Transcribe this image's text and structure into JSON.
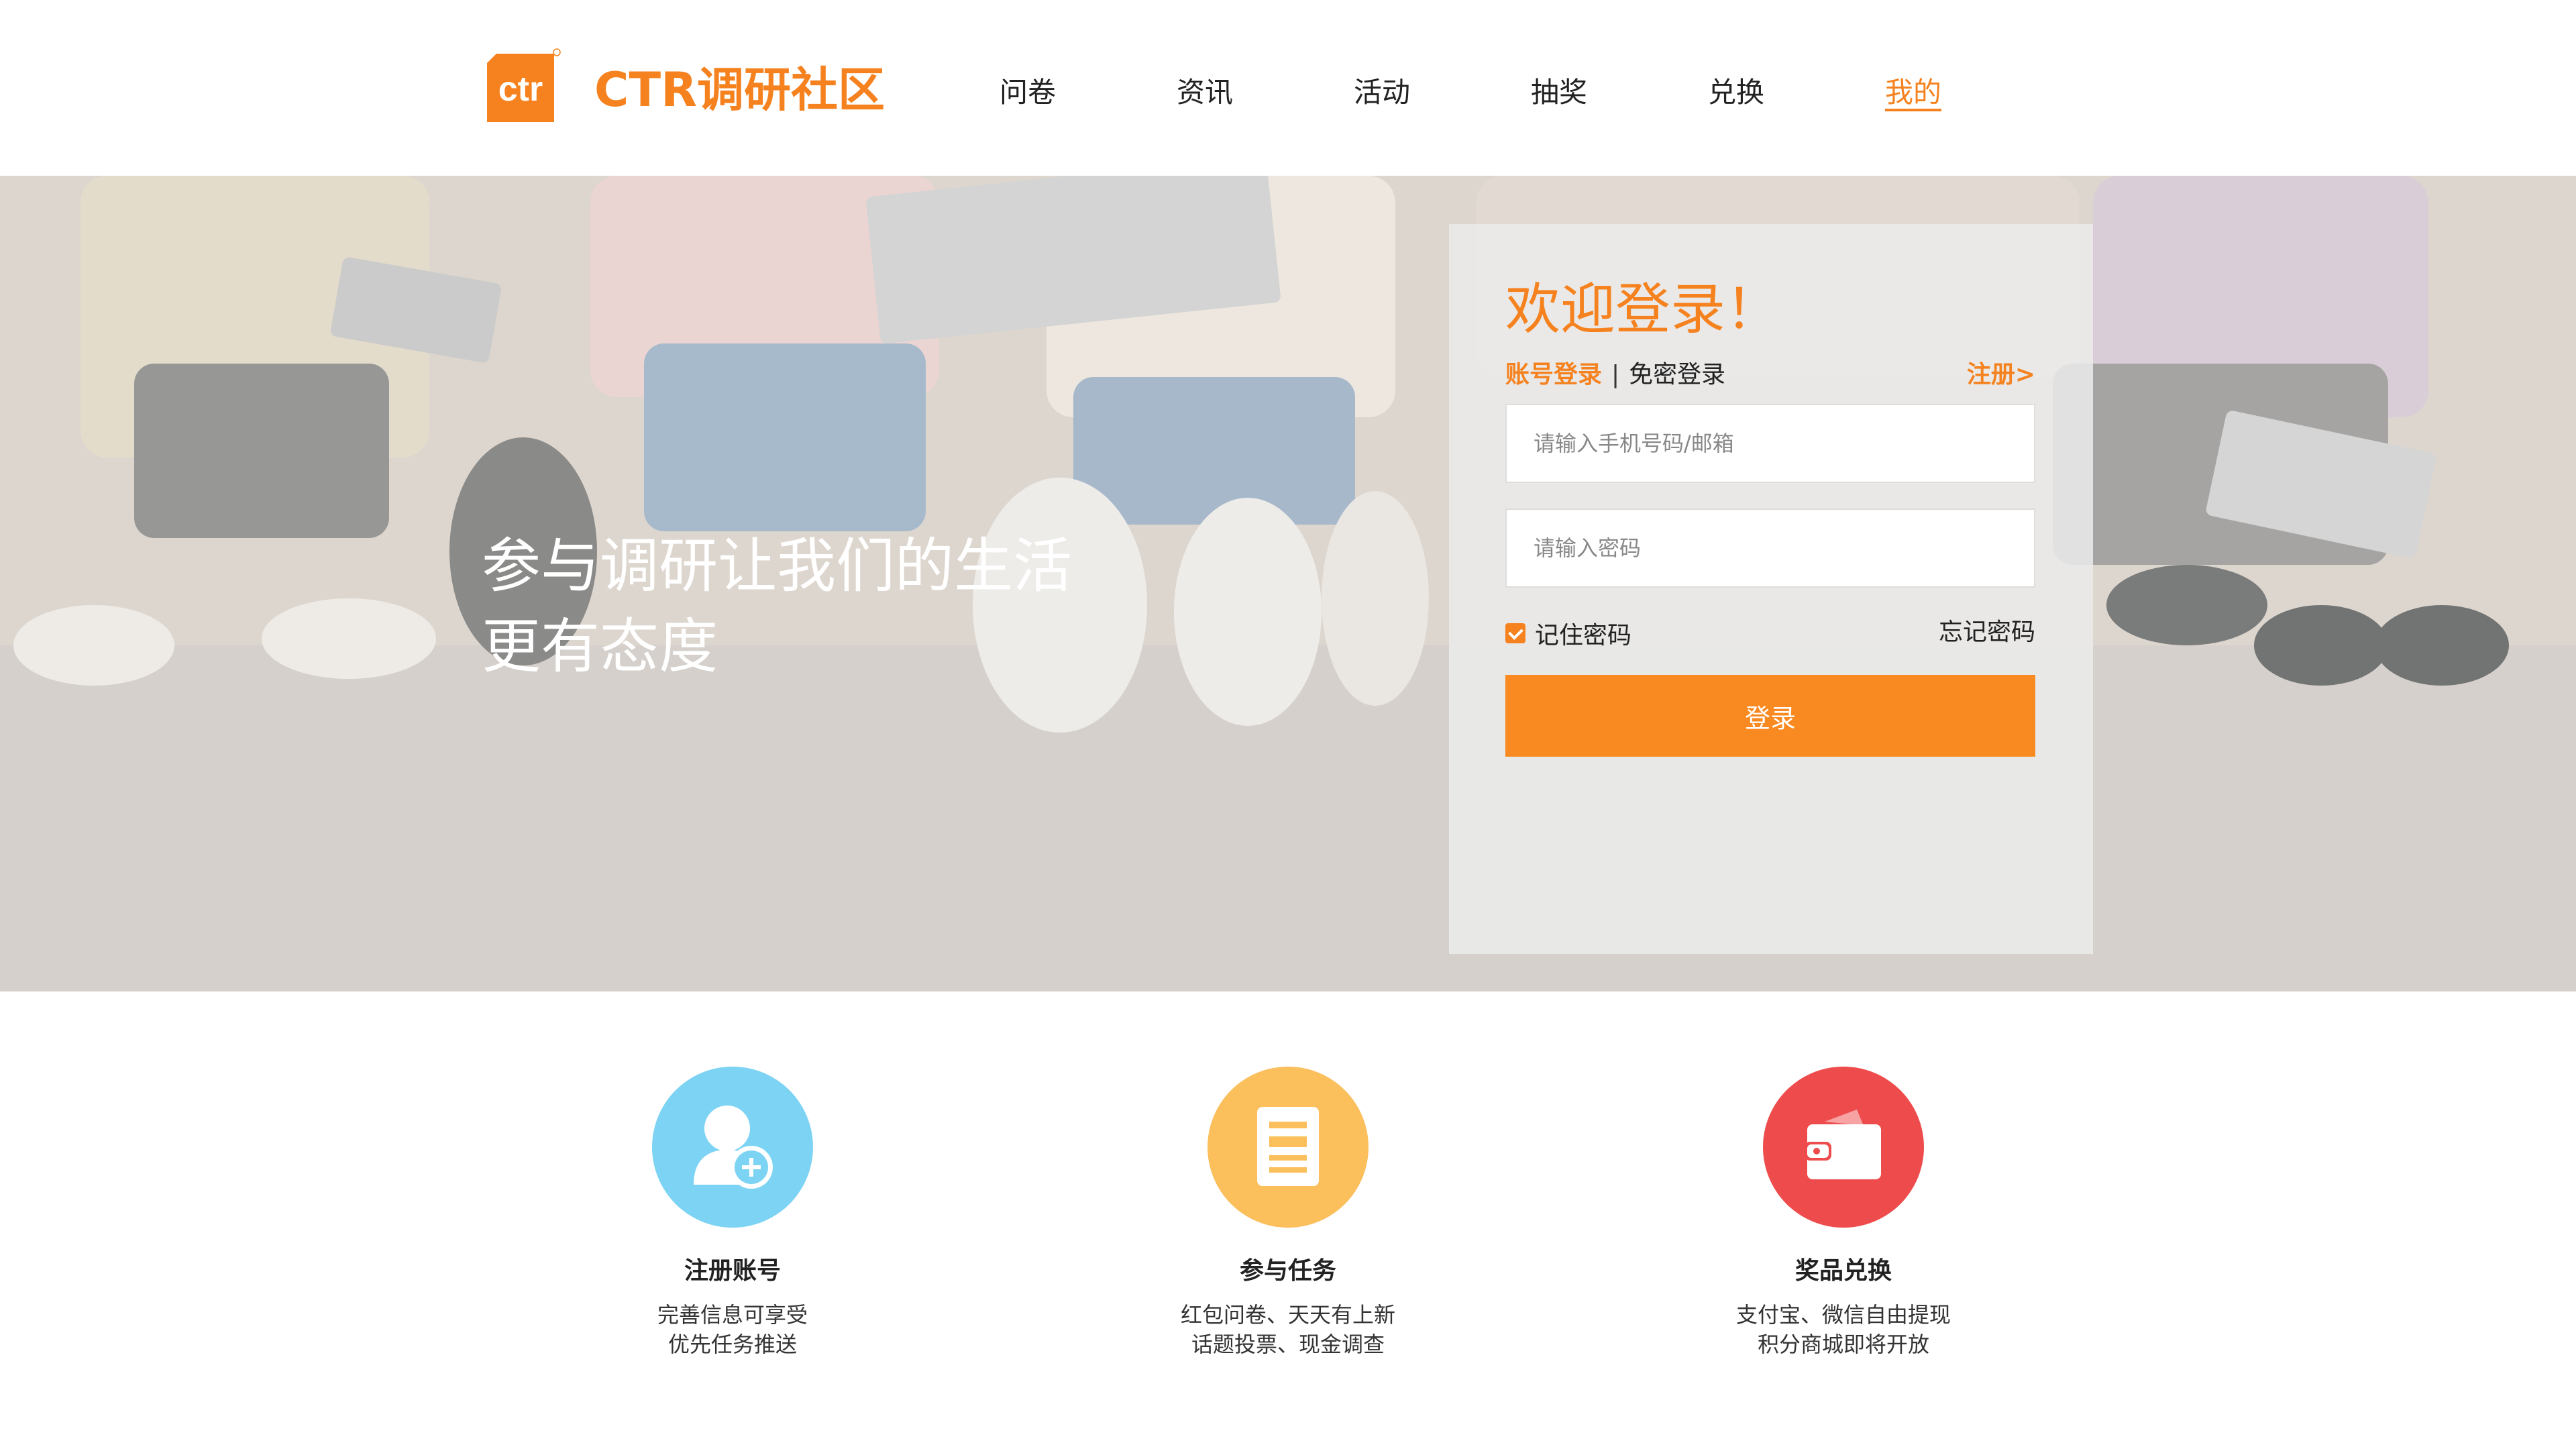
{
  "header": {
    "logo_text": "CTR调研社区",
    "nav": [
      {
        "label": "问卷",
        "active": false
      },
      {
        "label": "资讯",
        "active": false
      },
      {
        "label": "活动",
        "active": false
      },
      {
        "label": "抽奖",
        "active": false
      },
      {
        "label": "兑换",
        "active": false
      },
      {
        "label": "我的",
        "active": true
      }
    ],
    "brand_color": "#f5821f"
  },
  "hero": {
    "slogan_line1": "参与调研让我们的生活",
    "slogan_line2": "更有态度"
  },
  "login": {
    "title": "欢迎登录！",
    "tab_account": "账号登录",
    "tab_separator": "|",
    "tab_password_free": "免密登录",
    "register_link": "注册>",
    "phone_placeholder": "请输入手机号码/邮箱",
    "password_placeholder": "请输入密码",
    "remember_label": "记住密码",
    "remember_checked": true,
    "forgot_label": "忘记密码",
    "submit_label": "登录"
  },
  "features": [
    {
      "icon": "add-user-icon",
      "color": "#7dd3f4",
      "title": "注册账号",
      "desc_line1": "完善信息可享受",
      "desc_line2": "优先任务推送"
    },
    {
      "icon": "document-icon",
      "color": "#fbbf5c",
      "title": "参与任务",
      "desc_line1": "红包问卷、天天有上新",
      "desc_line2": "话题投票、现金调查"
    },
    {
      "icon": "wallet-icon",
      "color": "#ee4c4c",
      "title": "奖品兑换",
      "desc_line1": "支付宝、微信自由提现",
      "desc_line2": "积分商城即将开放"
    }
  ]
}
